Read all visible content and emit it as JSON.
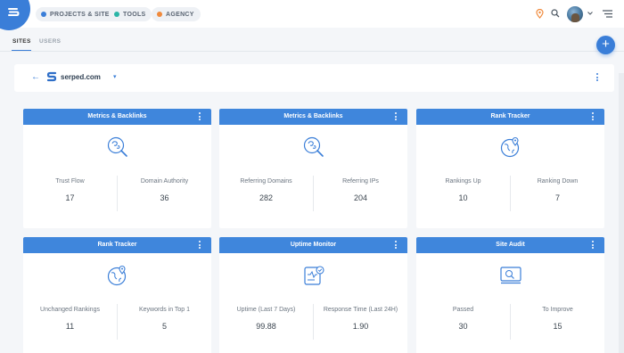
{
  "topbar": {
    "nav": [
      {
        "label": "PROJECTS & SITES",
        "icon": "globe-icon",
        "color": "#3a7ed8"
      },
      {
        "label": "TOOLS",
        "icon": "tools-icon",
        "color": "#2bb5a7"
      },
      {
        "label": "AGENCY",
        "icon": "agency-icon",
        "color": "#f08a3c"
      }
    ]
  },
  "tabs": {
    "sites": "SITES",
    "users": "USERS"
  },
  "fab": {
    "label": "+"
  },
  "site": {
    "back": "←",
    "name": "serped.com",
    "caret": "▾"
  },
  "cards": [
    {
      "title": "Metrics & Backlinks",
      "icon": "backlinks-icon",
      "metrics": [
        {
          "label": "Trust Flow",
          "value": "17"
        },
        {
          "label": "Domain Authority",
          "value": "36"
        }
      ]
    },
    {
      "title": "Metrics & Backlinks",
      "icon": "backlinks-icon",
      "metrics": [
        {
          "label": "Referring Domains",
          "value": "282"
        },
        {
          "label": "Referring IPs",
          "value": "204"
        }
      ]
    },
    {
      "title": "Rank Tracker",
      "icon": "globe-pin-icon",
      "metrics": [
        {
          "label": "Rankings Up",
          "value": "10"
        },
        {
          "label": "Ranking Down",
          "value": "7"
        }
      ]
    },
    {
      "title": "Rank Tracker",
      "icon": "globe-pin-icon",
      "metrics": [
        {
          "label": "Unchanged Rankings",
          "value": "11"
        },
        {
          "label": "Keywords in Top 1",
          "value": "5"
        }
      ]
    },
    {
      "title": "Uptime Monitor",
      "icon": "uptime-icon",
      "metrics": [
        {
          "label": "Uptime (Last 7 Days)",
          "value": "99.88"
        },
        {
          "label": "Response Time (Last 24H)",
          "value": "1.90"
        }
      ]
    },
    {
      "title": "Site Audit",
      "icon": "audit-icon",
      "metrics": [
        {
          "label": "Passed",
          "value": "30"
        },
        {
          "label": "To Improve",
          "value": "15"
        }
      ]
    }
  ],
  "colors": {
    "accent": "#3a7ed8",
    "card_header": "#3f86dc",
    "background": "#f4f6f9"
  }
}
